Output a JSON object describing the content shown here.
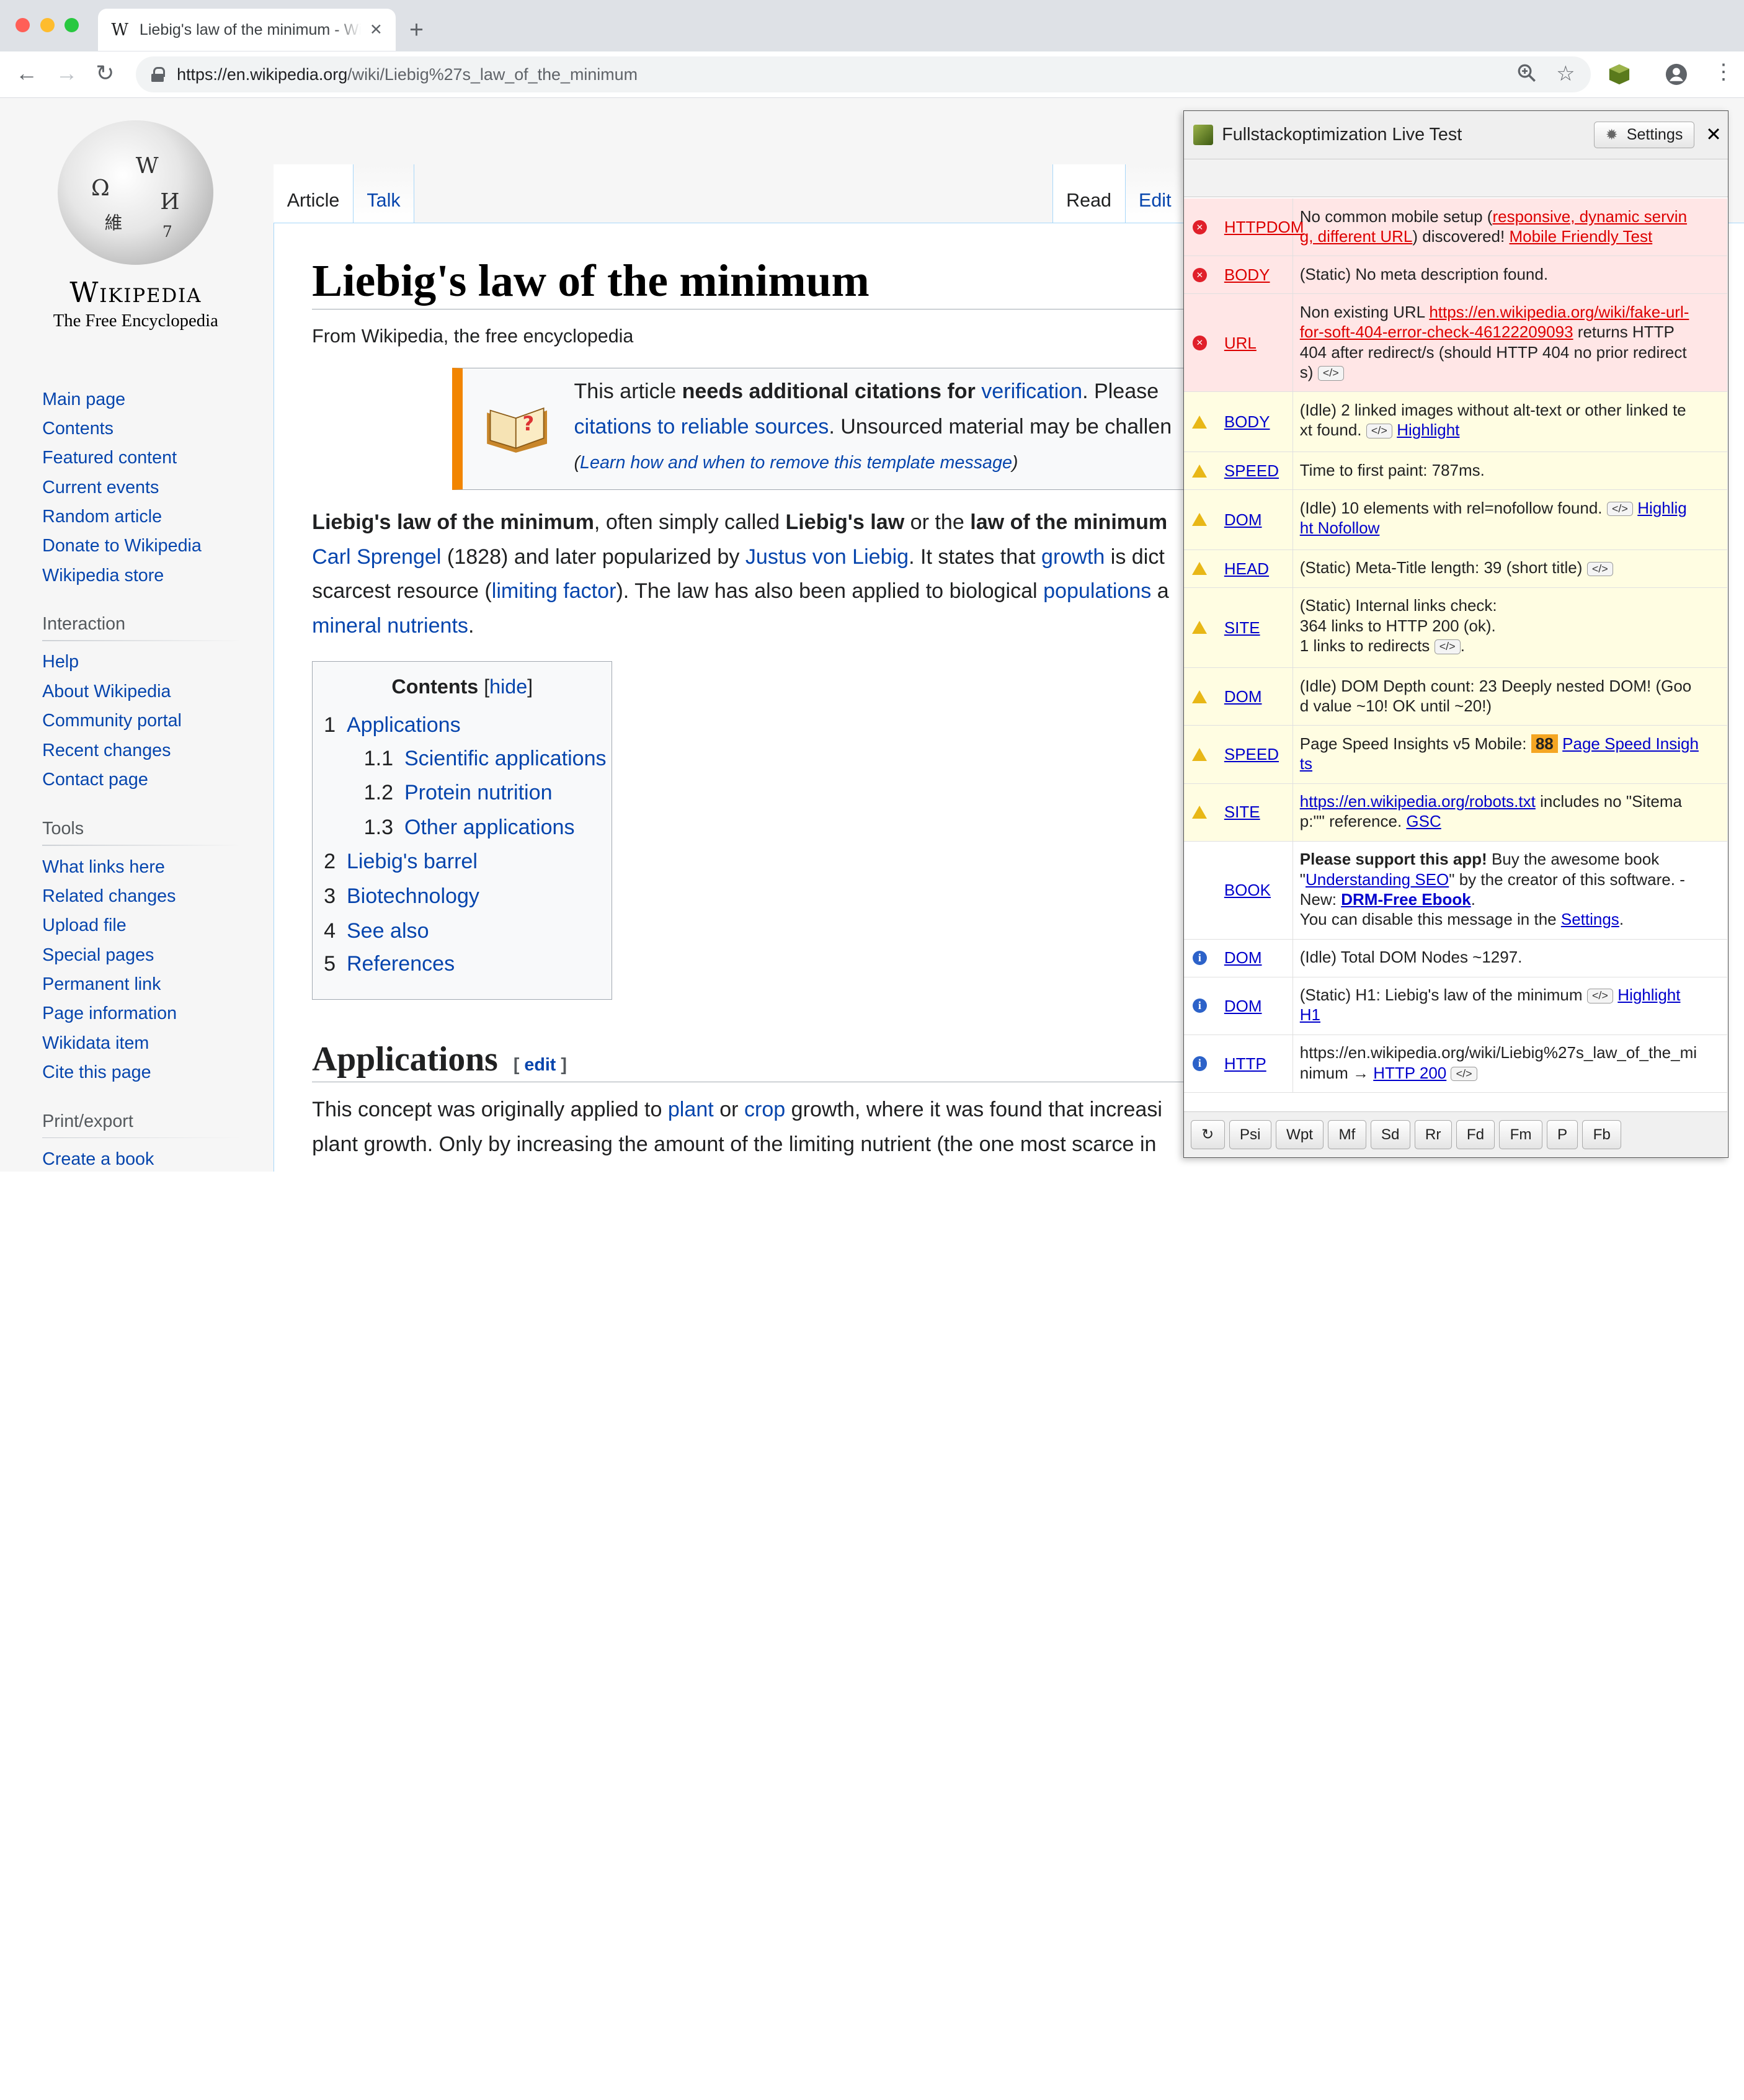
{
  "browser": {
    "tab_title": "Liebig's law of the minimum - Wikipedia",
    "tab_favicon": "W",
    "tab_close": "✕",
    "new_tab": "+",
    "url_host": "https://en.wikipedia.org",
    "url_path": "/wiki/Liebig%27s_law_of_the_minimum"
  },
  "wiki": {
    "wordmark": "Wikipedia",
    "tagline": "The Free Encyclopedia",
    "nav_main": [
      "Main page",
      "Contents",
      "Featured content",
      "Current events",
      "Random article",
      "Donate to Wikipedia",
      "Wikipedia store"
    ],
    "interaction_heading": "Interaction",
    "interaction": [
      "Help",
      "About Wikipedia",
      "Community portal",
      "Recent changes",
      "Contact page"
    ],
    "tools_heading": "Tools",
    "tools": [
      "What links here",
      "Related changes",
      "Upload file",
      "Special pages",
      "Permanent link",
      "Page information",
      "Wikidata item",
      "Cite this page"
    ],
    "print_heading": "Print/export",
    "print": [
      "Create a book"
    ],
    "tabs_left": [
      "Article",
      "Talk"
    ],
    "tabs_right": [
      "Read",
      "Edit"
    ],
    "title": "Liebig's law of the minimum",
    "site_sub": "From Wikipedia, the free encyclopedia",
    "ambox": {
      "l1a": "This article ",
      "l1b": "needs additional citations for ",
      "l1c": "verification",
      "l1d": ". Please",
      "l2a": "citations to reliable sources",
      "l2b": ". Unsourced material may be challen",
      "l3a": "(",
      "l3b": "Learn how and when to remove this template message",
      "l3c": ")"
    },
    "lead": {
      "l1a": "Liebig's law of the minimum",
      "l1b": ", often simply called ",
      "l1c": "Liebig's law",
      "l1d": " or the ",
      "l1e": "law of the minimum",
      "l2a": "Carl Sprengel",
      "l2b": " (1828) and later popularized by ",
      "l2c": "Justus von Liebig",
      "l2d": ". It states that ",
      "l2e": "growth",
      "l2f": " is dict",
      "l3a": "scarcest resource (",
      "l3b": "limiting factor",
      "l3c": "). The law has also been applied to biological ",
      "l3d": "populations",
      "l3e": " a",
      "l4a": "mineral nutrients",
      "l4b": "."
    },
    "toc": {
      "title": "Contents",
      "hide": "hide",
      "items": [
        {
          "num": "1",
          "label": "Applications"
        },
        {
          "num": "1.1",
          "label": "Scientific applications"
        },
        {
          "num": "1.2",
          "label": "Protein nutrition"
        },
        {
          "num": "1.3",
          "label": "Other applications"
        },
        {
          "num": "2",
          "label": "Liebig's barrel"
        },
        {
          "num": "3",
          "label": "Biotechnology"
        },
        {
          "num": "4",
          "label": "See also"
        },
        {
          "num": "5",
          "label": "References"
        }
      ]
    },
    "section": {
      "title": "Applications",
      "edit": "edit"
    },
    "body": {
      "l1a": "This concept was originally applied to ",
      "l1b": "plant",
      "l1c": " or ",
      "l1d": "crop",
      "l1e": " growth, where it was found that increasi",
      "l2a": "plant growth. Only by increasing the amount of the limiting nutrient (the one most scarce in"
    }
  },
  "ext": {
    "title": "Fullstackoptimization Live Test",
    "settings": "Settings",
    "close": "✕",
    "code_label": "</>",
    "rows": [
      {
        "sev": "err",
        "tag1": "HTTP",
        "tag2": "DOM",
        "t1": "No common mobile setup (",
        "l1": "responsive, dynamic servin",
        "t2": "",
        "l2": "g, different URL",
        "t3": ") discovered! ",
        "l3": "Mobile Friendly Test"
      },
      {
        "sev": "err",
        "tag": "BODY",
        "text": "(Static) No meta description found."
      },
      {
        "sev": "err",
        "tag": "URL",
        "t1": "Non existing URL ",
        "l1": "https://en.wikipedia.org/wiki/fake-url-",
        "l2": "for-soft-404-error-check-46122209093",
        "t2": " returns HTTP",
        "t3": "404 after redirect/s (should HTTP 404 no prior redirect",
        "t4": "s)"
      },
      {
        "sev": "warn",
        "tag": "BODY",
        "t1": "(Idle) 2 linked images without alt-text or other linked te",
        "t2": "xt found.",
        "link": "Highlight"
      },
      {
        "sev": "warn",
        "tag": "SPEED",
        "text": "Time to first paint: 787ms."
      },
      {
        "sev": "warn",
        "tag": "DOM",
        "t1": "(Idle) 10 elements with rel=nofollow found.",
        "l1": "Highlig",
        "l2": "ht Nofollow"
      },
      {
        "sev": "warn",
        "tag": "HEAD",
        "text": "(Static) Meta-Title length: 39 (short title)"
      },
      {
        "sev": "warn",
        "tag": "SITE",
        "t1": "(Static) Internal links check:",
        "t2": "364 links to HTTP 200 (ok).",
        "t3": "1 links to redirects",
        "t4": "."
      },
      {
        "sev": "warn",
        "tag": "DOM",
        "t1": "(Idle) DOM Depth count: 23 Deeply nested DOM! (Goo",
        "t2": "d value ~10! OK until ~20!)"
      },
      {
        "sev": "warn",
        "tag": "SPEED",
        "t1": "Page Speed Insights v5 Mobile: ",
        "score": "88",
        "l1": "Page Speed Insigh",
        "l2": "ts"
      },
      {
        "sev": "warn",
        "tag": "SITE",
        "l1": "https://en.wikipedia.org/robots.txt",
        "t1": " includes no \"Sitema",
        "t2": "p:\"\" reference. ",
        "l2": "GSC"
      },
      {
        "sev": "none",
        "tag": "BOOK",
        "b1": "Please support this app!",
        "t1": " Buy the awesome book",
        "t2": "\"",
        "l1": "Understanding SEO",
        "t3": "\" by the creator of this software. -",
        "t4": "New: ",
        "b2": "DRM-Free Ebook",
        "t5": ".",
        "t6": "You can disable this message in the ",
        "l2": "Settings",
        "t7": "."
      },
      {
        "sev": "info",
        "tag": "DOM",
        "text": "(Idle) Total DOM Nodes ~1297."
      },
      {
        "sev": "info",
        "tag": "DOM",
        "t1": "(Static) H1: Liebig's law of the minimum",
        "l1": "Highlight",
        "l2": "H1"
      },
      {
        "sev": "info",
        "tag": "HTTP",
        "t1": "https://en.wikipedia.org/wiki/Liebig%27s_law_of_the_mi",
        "t2": "nimum → ",
        "l1": "HTTP 200"
      }
    ],
    "footer_buttons": [
      "↻",
      "Psi",
      "Wpt",
      "Mf",
      "Sd",
      "Rr",
      "Fd",
      "Fm",
      "P",
      "Fb"
    ]
  },
  "colors": {
    "wiki_link": "#0645ad",
    "error_bg": "#ffe6e6",
    "warn_bg": "#fffde2",
    "ambox_accent": "#f28500",
    "score_bg": "#f5a623"
  }
}
